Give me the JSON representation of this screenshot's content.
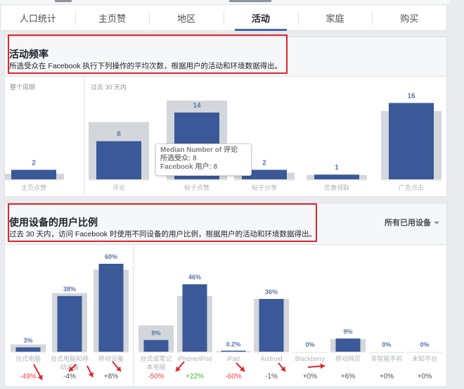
{
  "tabs": [
    {
      "label": "人口统计",
      "active": false
    },
    {
      "label": "主页赞",
      "active": false
    },
    {
      "label": "地区",
      "active": false
    },
    {
      "label": "活动",
      "active": true
    },
    {
      "label": "家庭",
      "active": false
    },
    {
      "label": "购买",
      "active": false
    }
  ],
  "activity": {
    "title": "活动频率",
    "subtitle": "所选受众在 Facebook 执行下列操作的平均次数，根据用户的活动和环境数据得出。",
    "left_caption": "整个周期",
    "right_caption": "过去 30 天内"
  },
  "devices": {
    "title": "使用设备的用户比例",
    "subtitle": "过去 30 天内，访问 Facebook 时使用不同设备的用户比例，根据用户的活动和环境数据得出。",
    "dropdown": "所有已用设备"
  },
  "tooltip": {
    "title": "Median Number of 评论",
    "line1": "所选受众: 8",
    "line2": "Facebook 用户: 8"
  },
  "colors": {
    "bar": "#3b5998",
    "baseline": "#d3d6db",
    "positive": "#42b72a",
    "negative": "#fa3e3e",
    "annotation_red": "#e0252b"
  },
  "chart_data": [
    {
      "type": "bar",
      "title": "活动频率",
      "categories": [
        "主页点赞",
        "评论",
        "帖子点赞",
        "帖子分享",
        "优惠领取",
        "广告点击"
      ],
      "series": [
        {
          "values": [
            2,
            8,
            14,
            2,
            1,
            16
          ],
          "labels": [
            "2",
            "8",
            "14",
            "2",
            "1",
            "16"
          ]
        },
        {
          "values": [
            1.2,
            12,
            16.5,
            1.4,
            0.9,
            14.3
          ]
        }
      ],
      "groups": [
        "整个周期",
        "过去 30 天内"
      ]
    },
    {
      "type": "bar",
      "title": "使用设备的用户比例",
      "categories": [
        "台式电脑",
        "台式电脑和移动设备",
        "移动设备",
        "台式或笔记本电脑",
        "iPhone/iPod",
        "iPad",
        "Android",
        "Blackberry",
        "移动网页",
        "非智能手机",
        "未知平台"
      ],
      "category_labels": [
        [
          "台式电脑"
        ],
        [
          "台式电脑和移",
          "动设备"
        ],
        [
          "移动设备"
        ],
        [
          "台式或笔记",
          "本电脑"
        ],
        [
          "iPhone/iPod"
        ],
        [
          "iPad"
        ],
        [
          "Android"
        ],
        [
          "Blackberry"
        ],
        [
          "移动网页"
        ],
        [
          "非智能手机"
        ],
        [
          "未知平台"
        ]
      ],
      "series": [
        {
          "values": [
            3,
            38,
            60,
            8,
            46,
            0.2,
            36,
            0,
            9,
            0,
            0
          ],
          "labels": [
            "3%",
            "38%",
            "60%",
            "8%",
            "46%",
            "0.2%",
            "36%",
            "0%",
            "9%",
            "0%",
            "0%"
          ]
        },
        {
          "values": [
            5,
            40,
            56,
            18,
            38,
            0.5,
            36,
            0,
            8.5,
            0,
            0
          ]
        }
      ],
      "comparisons": [
        "-49%",
        "-4%",
        "+8%",
        "-50%",
        "+22%",
        "-60%",
        "-1%",
        "+0%",
        "+6%",
        "+0%",
        "+0%"
      ]
    }
  ]
}
